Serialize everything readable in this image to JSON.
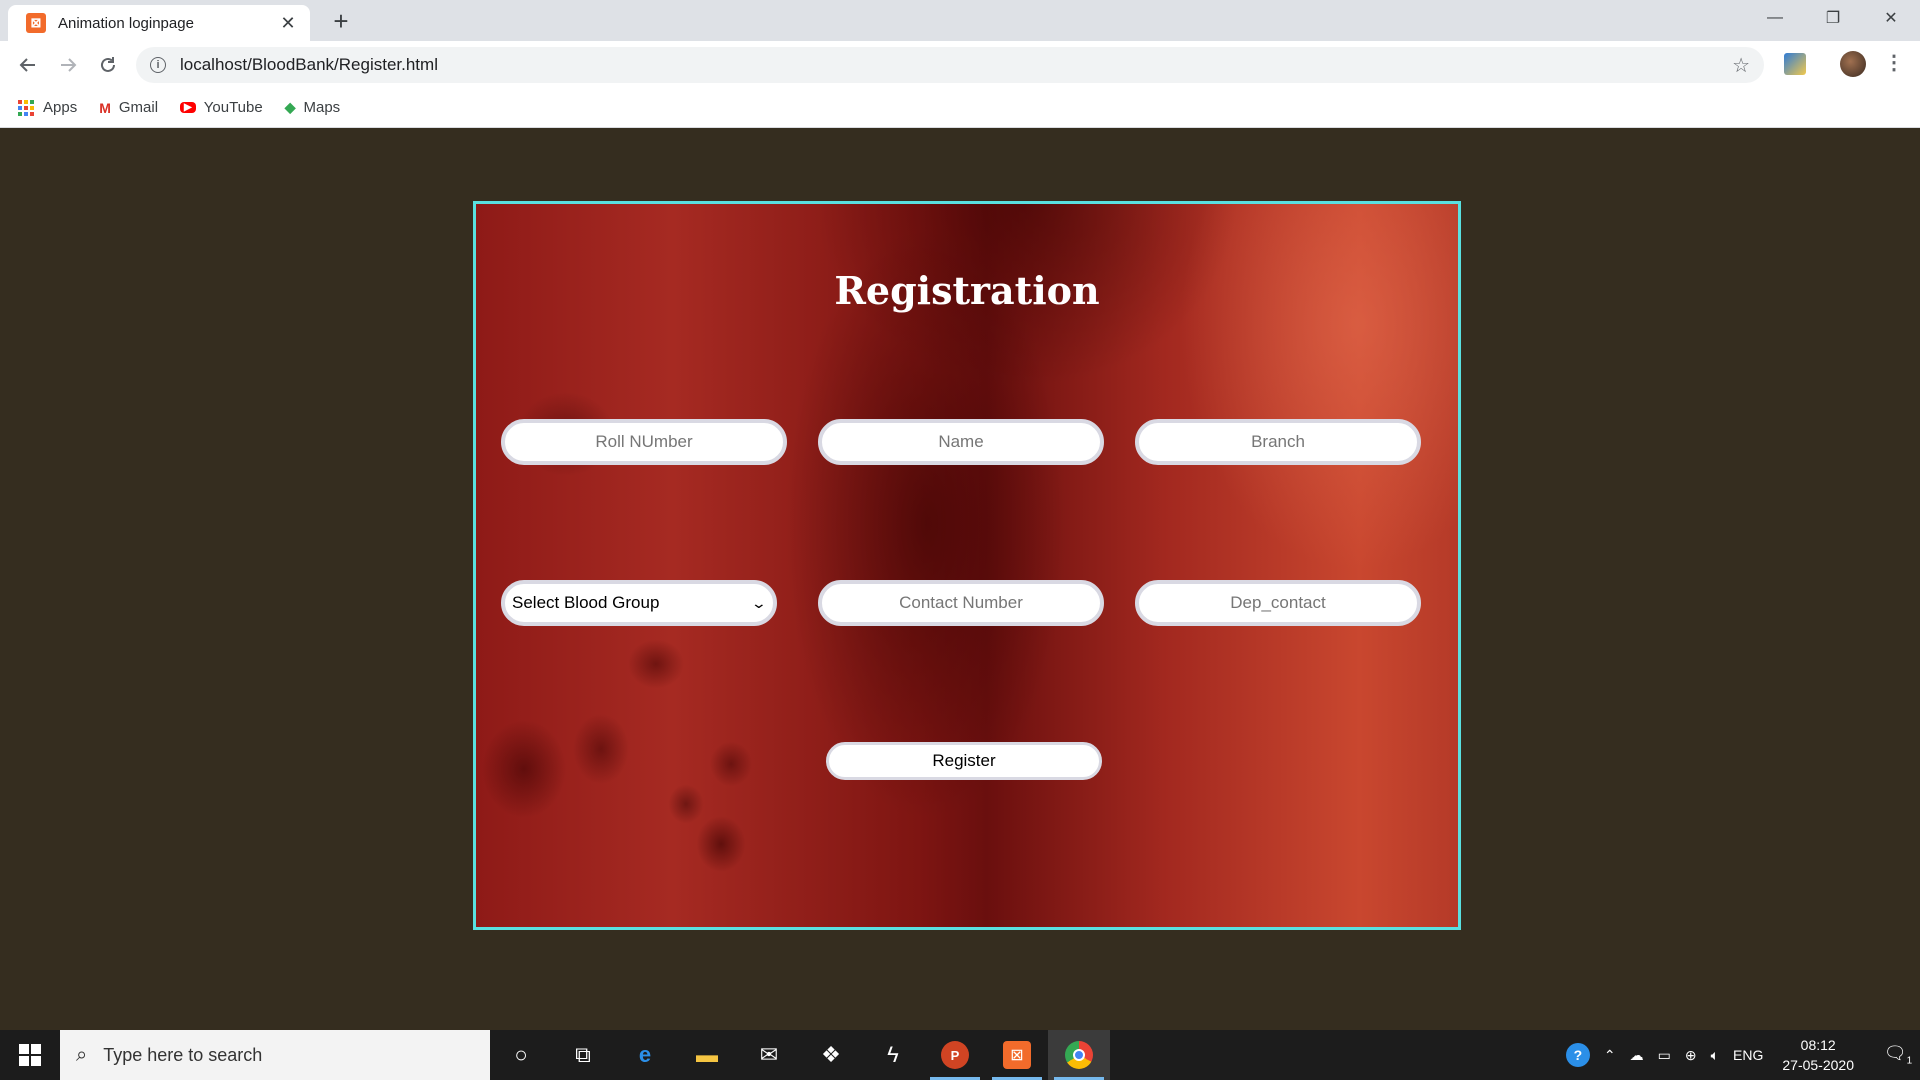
{
  "browser": {
    "tab_title": "Animation loginpage",
    "tab_close": "✕",
    "new_tab": "+",
    "url": "localhost/BloodBank/Register.html",
    "window_controls": {
      "minimize": "—",
      "restore": "❐",
      "close": "✕"
    },
    "bookmarks": [
      {
        "label": "Apps",
        "icon": "apps-grid-icon"
      },
      {
        "label": "Gmail",
        "icon": "gmail-icon"
      },
      {
        "label": "YouTube",
        "icon": "youtube-icon"
      },
      {
        "label": "Maps",
        "icon": "maps-icon"
      }
    ]
  },
  "form": {
    "title": "Registration",
    "roll_placeholder": "Roll NUmber",
    "name_placeholder": "Name",
    "branch_placeholder": "Branch",
    "blood_group_selected": "Select Blood Group",
    "contact_placeholder": "Contact Number",
    "dep_contact_placeholder": "Dep_contact",
    "register_label": "Register"
  },
  "taskbar": {
    "search_placeholder": "Type here to search",
    "language": "ENG",
    "time": "08:12",
    "date": "27-05-2020",
    "notification_count": "1"
  }
}
